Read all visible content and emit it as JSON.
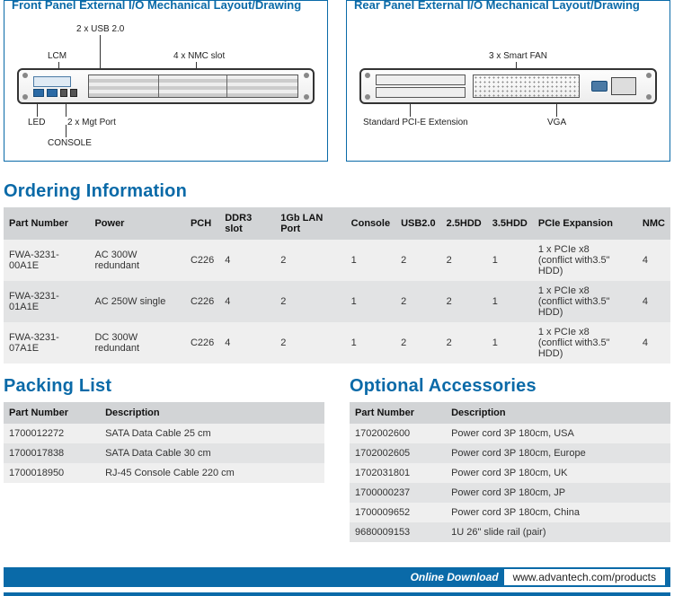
{
  "panels": {
    "front": {
      "title": "Front Panel External I/O Mechanical Layout/Drawing",
      "labels": {
        "usb": "2 x USB 2.0",
        "lcm": "LCM",
        "nmc": "4 x NMC slot",
        "led": "LED",
        "mgt": "2 x Mgt Port",
        "console": "CONSOLE"
      }
    },
    "rear": {
      "title": "Rear Panel External I/O Mechanical Layout/Drawing",
      "labels": {
        "fan": "3 x Smart FAN",
        "pcie": "Standard PCI-E Extension",
        "vga": "VGA"
      }
    }
  },
  "ordering": {
    "heading": "Ordering Information",
    "columns": [
      "Part Number",
      "Power",
      "PCH",
      "DDR3 slot",
      "1Gb LAN Port",
      "Console",
      "USB2.0",
      "2.5HDD",
      "3.5HDD",
      "PCIe Expansion",
      "NMC"
    ],
    "rows": [
      [
        "FWA-3231-00A1E",
        "AC 300W redundant",
        "C226",
        "4",
        "2",
        "1",
        "2",
        "2",
        "1",
        "1 x PCIe x8\n(conflict with3.5\" HDD)",
        "4"
      ],
      [
        "FWA-3231-01A1E",
        "AC 250W single",
        "C226",
        "4",
        "2",
        "1",
        "2",
        "2",
        "1",
        "1 x PCIe x8\n(conflict with3.5\" HDD)",
        "4"
      ],
      [
        "FWA-3231-07A1E",
        "DC 300W redundant",
        "C226",
        "4",
        "2",
        "1",
        "2",
        "2",
        "1",
        "1 x PCIe x8\n(conflict with3.5\" HDD)",
        "4"
      ]
    ]
  },
  "packing": {
    "heading": "Packing List",
    "columns": [
      "Part Number",
      "Description"
    ],
    "rows": [
      [
        "1700012272",
        "SATA Data Cable 25 cm"
      ],
      [
        "1700017838",
        "SATA Data Cable 30 cm"
      ],
      [
        "1700018950",
        "RJ-45 Console Cable 220 cm"
      ]
    ]
  },
  "accessories": {
    "heading": "Optional Accessories",
    "columns": [
      "Part Number",
      "Description"
    ],
    "rows": [
      [
        "1702002600",
        "Power cord 3P 180cm, USA"
      ],
      [
        "1702002605",
        "Power cord 3P 180cm, Europe"
      ],
      [
        "1702031801",
        "Power cord 3P 180cm, UK"
      ],
      [
        "1700000237",
        "Power cord 3P 180cm, JP"
      ],
      [
        "1700009652",
        "Power cord 3P 180cm, China"
      ],
      [
        "9680009153",
        "1U 26\" slide rail (pair)"
      ]
    ]
  },
  "footer": {
    "label": "Online Download",
    "url": "www.advantech.com/products"
  }
}
